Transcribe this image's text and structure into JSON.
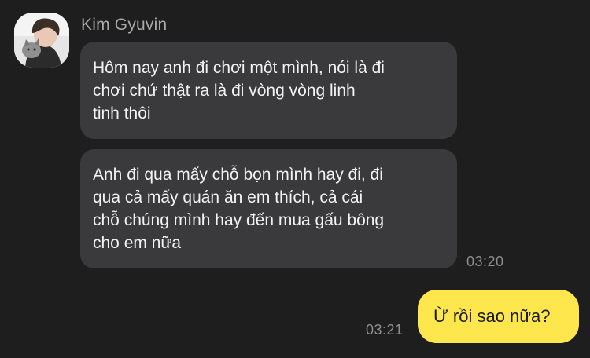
{
  "conversation": {
    "sender": {
      "name": "Kim Gyuvin",
      "avatar_icon": "profile-photo-avatar"
    },
    "incoming": [
      {
        "lines": [
          "Hôm nay anh đi chơi một mình, nói là đi",
          "chơi chứ thật ra là đi vòng vòng linh",
          "tinh thôi"
        ]
      },
      {
        "lines": [
          "Anh đi qua mấy chỗ bọn mình hay đi, đi",
          "qua cả mấy quán ăn em thích, cả cái",
          "chỗ chúng mình hay đến mua gấu bông",
          "cho em nữa"
        ],
        "time": "03:20"
      }
    ],
    "outgoing": [
      {
        "text": "Ừ rồi sao nữa?",
        "time": "03:21"
      }
    ]
  },
  "colors": {
    "background": "#1e1e1e",
    "incoming_bubble": "#3a3a3c",
    "outgoing_bubble": "#fde74d",
    "timestamp": "#8e8e8e",
    "sender_name": "#a9a9a9"
  }
}
